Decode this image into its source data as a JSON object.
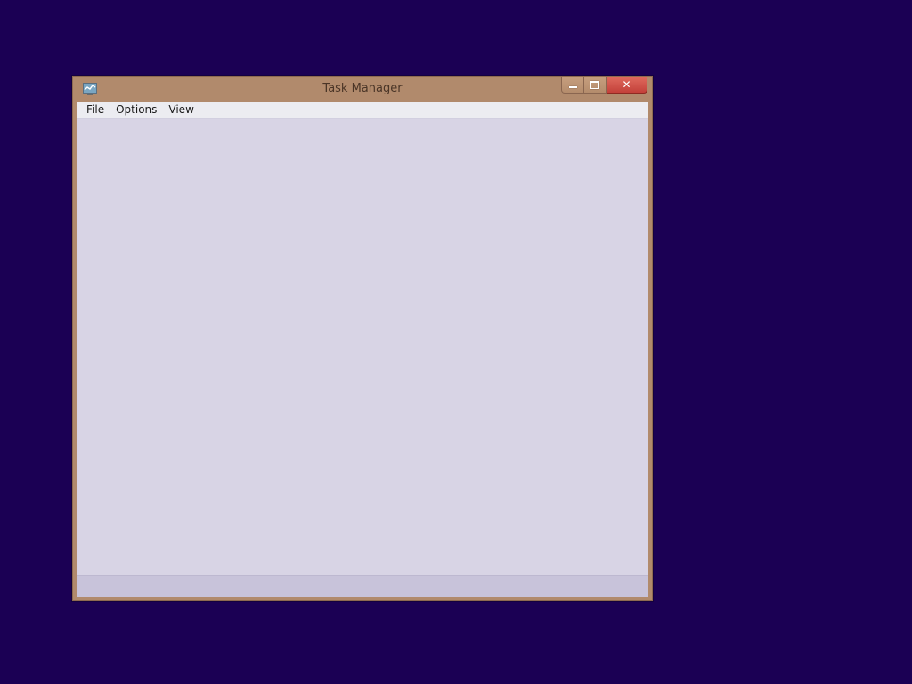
{
  "window": {
    "title": "Task Manager",
    "icon": "task-manager-icon",
    "controls": {
      "minimize": "minimize-icon",
      "maximize": "maximize-icon",
      "close": "close-icon",
      "close_glyph": "✕"
    }
  },
  "menubar": {
    "items": [
      {
        "label": "File"
      },
      {
        "label": "Options"
      },
      {
        "label": "View"
      }
    ]
  },
  "colors": {
    "desktop": "#1b0054",
    "frame": "#b18a6c",
    "client": "#d8d4e5",
    "close_button": "#c3413a"
  }
}
